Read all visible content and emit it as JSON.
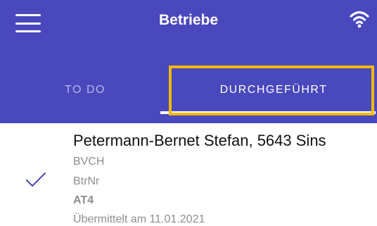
{
  "header": {
    "title": "Betriebe",
    "menu_icon": "hamburger-menu-icon",
    "status_icon": "wifi-icon",
    "background_color": "#4a48bd"
  },
  "tabs": [
    {
      "label": "TO DO",
      "selected": false
    },
    {
      "label": "DURCHGEFÜHRT",
      "selected": true
    }
  ],
  "highlight_color": "#f5b800",
  "items": [
    {
      "name": "Petermann-Bernet Stefan, 5643 Sins",
      "org": "BVCH",
      "btr_label": "BtrNr",
      "code": "AT4",
      "sent": "Übermittelt am 11.01.2021",
      "status_icon": "checkmark-icon"
    }
  ]
}
